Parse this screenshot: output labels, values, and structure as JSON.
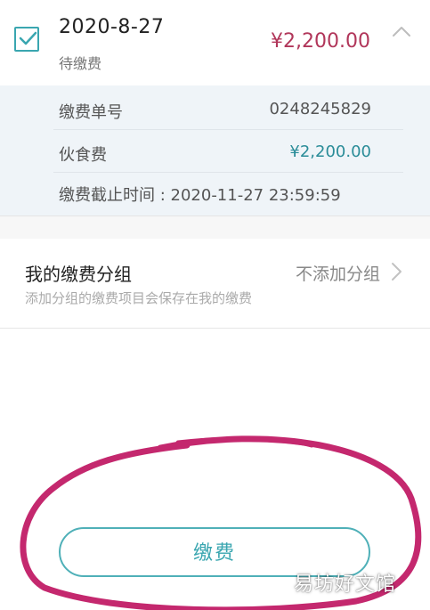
{
  "bill": {
    "date": "2020-8-27",
    "status": "待缴费",
    "amount": "¥2,200.00",
    "checked": true
  },
  "details": {
    "bill_no_label": "缴费单号",
    "bill_no_value": "0248245829",
    "fee_label": "伙食费",
    "fee_value": "¥2,200.00",
    "deadline_text": "缴费截止时间 : 2020-11-27 23:59:59"
  },
  "group": {
    "title": "我的缴费分组",
    "subtitle": "添加分组的缴费项目会保存在我的缴费",
    "value": "不添加分组"
  },
  "actions": {
    "pay_label": "缴费"
  },
  "watermark": {
    "text": "易坊好文馆"
  },
  "colors": {
    "accent": "#3aa6b0",
    "amount_red": "#b1365a",
    "annotation": "#c4286e"
  }
}
